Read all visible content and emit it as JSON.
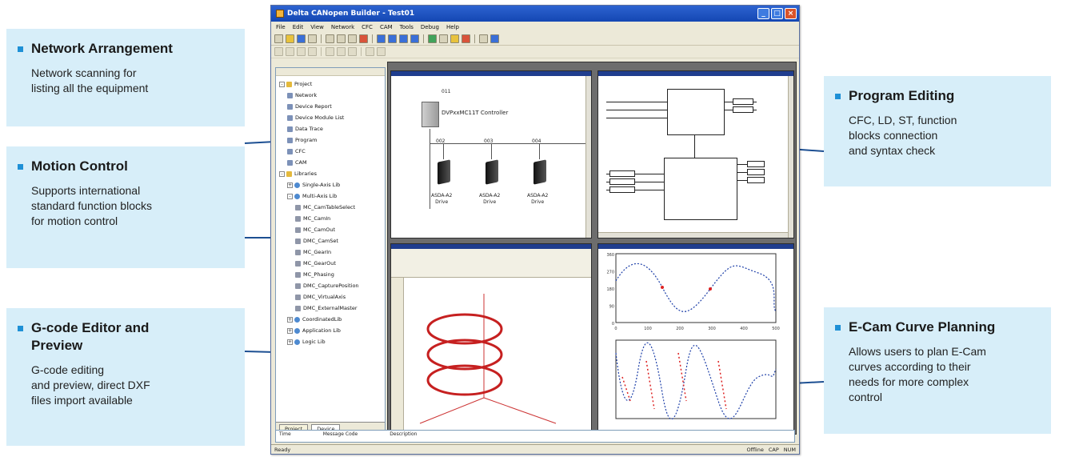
{
  "callouts": {
    "network": {
      "title": "Network Arrangement",
      "desc": "Network scanning for\nlisting all the equipment"
    },
    "motion": {
      "title": "Motion Control",
      "desc": "Supports international\nstandard function blocks\nfor motion control"
    },
    "gcode": {
      "title": "G-code Editor and\nPreview",
      "desc": "G-code editing\nand preview, direct DXF\nfiles import available"
    },
    "program": {
      "title": "Program Editing",
      "desc": "CFC, LD, ST, function\nblocks connection\nand syntax check"
    },
    "ecam": {
      "title": "E-Cam Curve Planning",
      "desc": "Allows users to plan E-Cam\ncurves according to their\nneeds for more complex\ncontrol"
    }
  },
  "window": {
    "title": "Delta CANopen Builder - Test01",
    "menu": [
      "File",
      "Edit",
      "View",
      "Network",
      "CFC",
      "CAM",
      "Tools",
      "Debug",
      "Help"
    ],
    "tree": [
      {
        "label": "Project",
        "level": 0,
        "icon": "folder-icon",
        "exp": "-"
      },
      {
        "label": "Network",
        "level": 1,
        "icon": "network-icon"
      },
      {
        "label": "Device Report",
        "level": 1,
        "icon": "report-icon"
      },
      {
        "label": "Device Module List",
        "level": 1,
        "icon": "list-icon"
      },
      {
        "label": "Data Trace",
        "level": 1,
        "icon": "trace-icon"
      },
      {
        "label": "Program",
        "level": 1,
        "icon": "program-icon"
      },
      {
        "label": "CFC",
        "level": 1,
        "icon": "cfc-icon"
      },
      {
        "label": "CAM",
        "level": 1,
        "icon": "cam-icon"
      },
      {
        "label": "Libraries",
        "level": 0,
        "icon": "folder-icon",
        "exp": "-"
      },
      {
        "label": "Single-Axis Lib",
        "level": 1,
        "icon": "lib-icon",
        "exp": "+"
      },
      {
        "label": "Multi-Axis Lib",
        "level": 1,
        "icon": "lib-icon",
        "exp": "-"
      },
      {
        "label": "MC_CamTableSelect",
        "level": 2,
        "icon": "function-block-icon"
      },
      {
        "label": "MC_CamIn",
        "level": 2,
        "icon": "function-block-icon"
      },
      {
        "label": "MC_CamOut",
        "level": 2,
        "icon": "function-block-icon"
      },
      {
        "label": "DMC_CamSet",
        "level": 2,
        "icon": "function-block-icon"
      },
      {
        "label": "MC_GearIn",
        "level": 2,
        "icon": "function-block-icon"
      },
      {
        "label": "MC_GearOut",
        "level": 2,
        "icon": "function-block-icon"
      },
      {
        "label": "MC_Phasing",
        "level": 2,
        "icon": "function-block-icon"
      },
      {
        "label": "DMC_CapturePosition",
        "level": 2,
        "icon": "function-block-icon"
      },
      {
        "label": "DMC_VirtualAxis",
        "level": 2,
        "icon": "function-block-icon"
      },
      {
        "label": "DMC_ExternalMaster",
        "level": 2,
        "icon": "function-block-icon"
      },
      {
        "label": "CoordinatedLib",
        "level": 1,
        "icon": "lib-icon",
        "exp": "+"
      },
      {
        "label": "Application Lib",
        "level": 1,
        "icon": "lib-icon",
        "exp": "+"
      },
      {
        "label": "Logic Lib",
        "level": 1,
        "icon": "lib-icon",
        "exp": "+"
      }
    ],
    "tree_tabs": [
      "Project",
      "Device"
    ],
    "network": {
      "controller_id": "011",
      "controller_name": "DVPxxMC11T Controller",
      "drives": [
        {
          "id": "002",
          "name": "ASDA-A2\nDrive"
        },
        {
          "id": "003",
          "name": "ASDA-A2\nDrive"
        },
        {
          "id": "004",
          "name": "ASDA-A2\nDrive"
        }
      ]
    },
    "message_bar": [
      "Time",
      "Message Code",
      "Description"
    ],
    "status": {
      "left": "Ready",
      "right": [
        "Offline",
        "CAP",
        "NUM"
      ]
    }
  },
  "chart_top": {
    "x_ticks": [
      "0",
      "100",
      "200",
      "300",
      "400",
      "500"
    ],
    "y_ticks": [
      "360",
      "270",
      "180",
      "90",
      "0"
    ]
  }
}
